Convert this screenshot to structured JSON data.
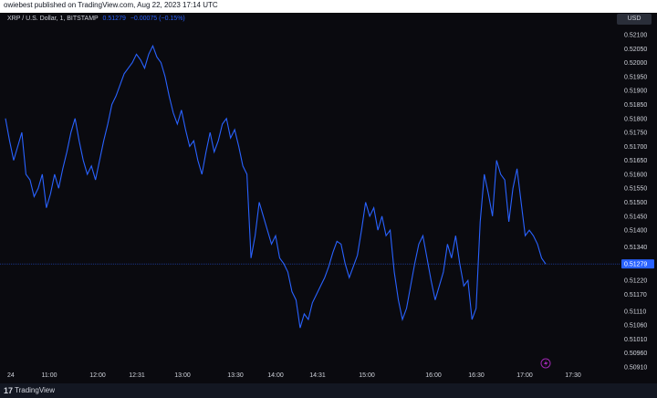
{
  "publisher_line": "owiebest published on TradingView.com, Aug 22, 2023 17:14 UTC",
  "legend": {
    "symbol": "XRP / U.S. Dollar, 1, BITSTAMP",
    "last_value": "0.51279",
    "change": "−0.00075 (−0.15%)"
  },
  "currency_button": "USD",
  "footer": {
    "logo_text": "17",
    "brand": "TradingView"
  },
  "colors": {
    "line": "#2962ff",
    "background": "#0a0a0f",
    "axis_text": "#d1d4dc",
    "price_label_bg": "#2962ff"
  },
  "icons": {
    "flash": "lightning-bolt-icon"
  },
  "chart_data": {
    "type": "line",
    "title": "XRP / U.S. Dollar, 1, BITSTAMP",
    "xlabel": "",
    "ylabel": "",
    "ylim": [
      0.5091,
      0.521
    ],
    "y_ticks": [
      "0.52100",
      "0.52050",
      "0.52000",
      "0.51950",
      "0.51900",
      "0.51850",
      "0.51800",
      "0.51750",
      "0.51700",
      "0.51650",
      "0.51600",
      "0.51550",
      "0.51500",
      "0.51450",
      "0.51400",
      "0.51340",
      "0.51279",
      "0.51220",
      "0.51170",
      "0.51110",
      "0.51060",
      "0.51010",
      "0.50960",
      "0.50910"
    ],
    "x_ticks": [
      "24",
      "11:00",
      "12:00",
      "12:31",
      "13:00",
      "13:30",
      "14:00",
      "14:31",
      "15:00",
      "16:00",
      "16:30",
      "17:00",
      "17:30"
    ],
    "current_price": 0.51279,
    "series": [
      {
        "values": [
          0.518,
          0.5172,
          0.5165,
          0.517,
          0.5175,
          0.516,
          0.5158,
          0.5152,
          0.5155,
          0.516,
          0.5148,
          0.5153,
          0.516,
          0.5155,
          0.5162,
          0.5168,
          0.5175,
          0.518,
          0.5172,
          0.5165,
          0.516,
          0.5163,
          0.5158,
          0.5165,
          0.5172,
          0.5178,
          0.5185,
          0.5188,
          0.5192,
          0.5196,
          0.5198,
          0.52,
          0.5203,
          0.5201,
          0.5198,
          0.5203,
          0.5206,
          0.5202,
          0.52,
          0.5195,
          0.5188,
          0.5182,
          0.5178,
          0.5183,
          0.5176,
          0.517,
          0.5172,
          0.5165,
          0.516,
          0.5168,
          0.5175,
          0.5168,
          0.5172,
          0.5178,
          0.518,
          0.5173,
          0.5176,
          0.517,
          0.5163,
          0.516,
          0.513,
          0.5138,
          0.515,
          0.5145,
          0.514,
          0.5135,
          0.5138,
          0.513,
          0.5128,
          0.5125,
          0.5118,
          0.5115,
          0.5105,
          0.511,
          0.5108,
          0.5114,
          0.5117,
          0.512,
          0.5123,
          0.5127,
          0.5132,
          0.5136,
          0.5135,
          0.5128,
          0.5123,
          0.5127,
          0.5131,
          0.514,
          0.515,
          0.5145,
          0.5148,
          0.514,
          0.5145,
          0.5138,
          0.514,
          0.5125,
          0.5115,
          0.5108,
          0.5112,
          0.512,
          0.5128,
          0.5135,
          0.5138,
          0.513,
          0.5122,
          0.5115,
          0.512,
          0.5125,
          0.5135,
          0.513,
          0.5138,
          0.5128,
          0.512,
          0.5122,
          0.5108,
          0.5112,
          0.5143,
          0.516,
          0.5153,
          0.5145,
          0.5165,
          0.516,
          0.5158,
          0.5143,
          0.5155,
          0.5162,
          0.515,
          0.5138,
          0.514,
          0.5138,
          0.5135,
          0.513,
          0.51279
        ]
      }
    ]
  }
}
